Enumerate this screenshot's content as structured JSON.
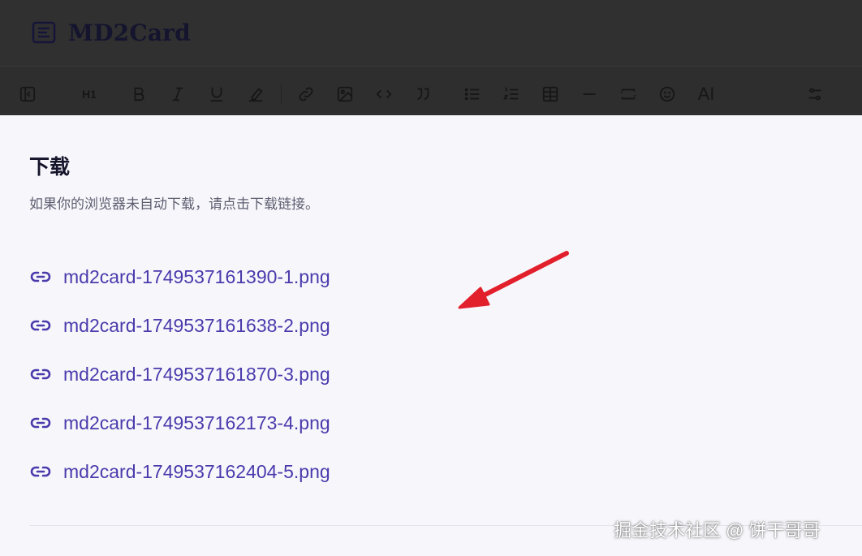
{
  "header": {
    "brand_title": "MD2Card",
    "brand_icon": "notes-icon"
  },
  "toolbar": {
    "heading_label": "H1",
    "ai_label": "AI",
    "icons": [
      "sidebar-toggle-icon",
      "heading-icon",
      "bold-icon",
      "italic-icon",
      "underline-icon",
      "clear-format-icon",
      "link-icon",
      "image-icon",
      "code-icon",
      "quote-icon",
      "bullet-list-icon",
      "numbered-list-icon",
      "table-icon",
      "horizontal-rule-icon",
      "code-block-icon",
      "emoji-icon",
      "ai-icon",
      "settings-sliders-icon"
    ]
  },
  "dialog": {
    "title": "下载",
    "description": "如果你的浏览器未自动下载，请点击下载链接。",
    "files": [
      "md2card-1749537161390-1.png",
      "md2card-1749537161638-2.png",
      "md2card-1749537161870-3.png",
      "md2card-1749537162173-4.png",
      "md2card-1749537162404-5.png"
    ]
  },
  "annotation": {
    "color": "#e2202c"
  },
  "watermark": "掘金技术社区 @ 饼干哥哥",
  "colors": {
    "overlay": "#2e2e2e",
    "dialog_bg": "#f7f7fb",
    "link": "#4a3aac",
    "title": "#14142b"
  }
}
